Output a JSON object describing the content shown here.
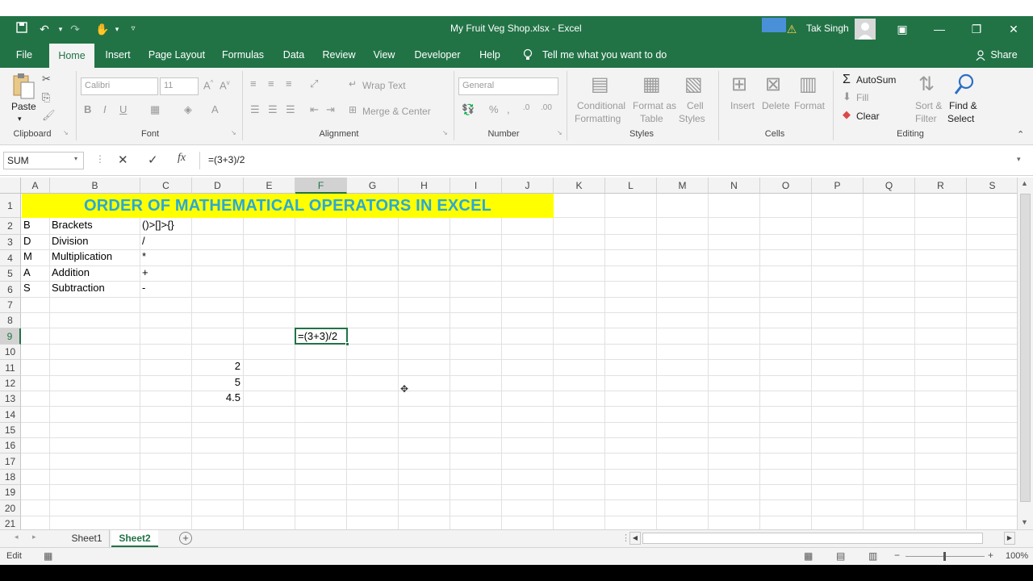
{
  "window": {
    "title": "My Fruit Veg Shop.xlsx  -  Excel",
    "user": "Tak Singh"
  },
  "tabs": [
    "File",
    "Home",
    "Insert",
    "Page Layout",
    "Formulas",
    "Data",
    "Review",
    "View",
    "Developer",
    "Help"
  ],
  "tell_me": "Tell me what you want to do",
  "share": "Share",
  "ribbon": {
    "clipboard": {
      "paste": "Paste",
      "label": "Clipboard"
    },
    "font": {
      "name": "Calibri",
      "size": "11",
      "bold": "B",
      "italic": "I",
      "underline": "U",
      "label": "Font"
    },
    "alignment": {
      "wrap": "Wrap Text",
      "merge": "Merge & Center",
      "label": "Alignment"
    },
    "number": {
      "format": "General",
      "percent": "%",
      "label": "Number"
    },
    "styles": {
      "cond_1": "Conditional",
      "cond_2": "Formatting",
      "fmt_1": "Format as",
      "fmt_2": "Table",
      "cell_1": "Cell",
      "cell_2": "Styles",
      "label": "Styles"
    },
    "cells": {
      "insert": "Insert",
      "delete": "Delete",
      "format": "Format",
      "label": "Cells"
    },
    "editing": {
      "autosum": "AutoSum",
      "fill": "Fill",
      "clear": "Clear",
      "sort_1": "Sort &",
      "sort_2": "Filter",
      "find_1": "Find &",
      "find_2": "Select",
      "label": "Editing"
    }
  },
  "formula_bar": {
    "name_box": "SUM",
    "cancel": "✕",
    "enter": "✓",
    "fx": "fx",
    "formula": "=(3+3)/2"
  },
  "columns": [
    "A",
    "B",
    "C",
    "D",
    "E",
    "F",
    "G",
    "H",
    "I",
    "J",
    "K",
    "L",
    "M",
    "N",
    "O",
    "P",
    "Q",
    "R",
    "S"
  ],
  "rows": [
    "1",
    "2",
    "3",
    "4",
    "5",
    "6",
    "7",
    "8",
    "9",
    "10",
    "11",
    "12",
    "13",
    "14",
    "15",
    "16",
    "17",
    "18",
    "19",
    "20",
    "21"
  ],
  "sheet": {
    "title": "ORDER OF MATHEMATICAL OPERATORS IN EXCEL",
    "operators": [
      {
        "a": "B",
        "b": "Brackets",
        "c": "()>[]>{}"
      },
      {
        "a": "D",
        "b": "Division",
        "c": "/"
      },
      {
        "a": "M",
        "b": "Multiplication",
        "c": "*"
      },
      {
        "a": "A",
        "b": "Addition",
        "c": "+"
      },
      {
        "a": "S",
        "b": "Subtraction",
        "c": "-"
      }
    ],
    "d11": "2",
    "d12": "5",
    "d13": "4.5",
    "active_cell_text": "=(3+3)/2"
  },
  "sheet_tabs": [
    "Sheet1",
    "Sheet2"
  ],
  "status": {
    "mode": "Edit",
    "zoom": "100%"
  },
  "colors": {
    "accent": "#217346",
    "title_fill": "#ffff00",
    "title_text": "#2aa9d4"
  }
}
